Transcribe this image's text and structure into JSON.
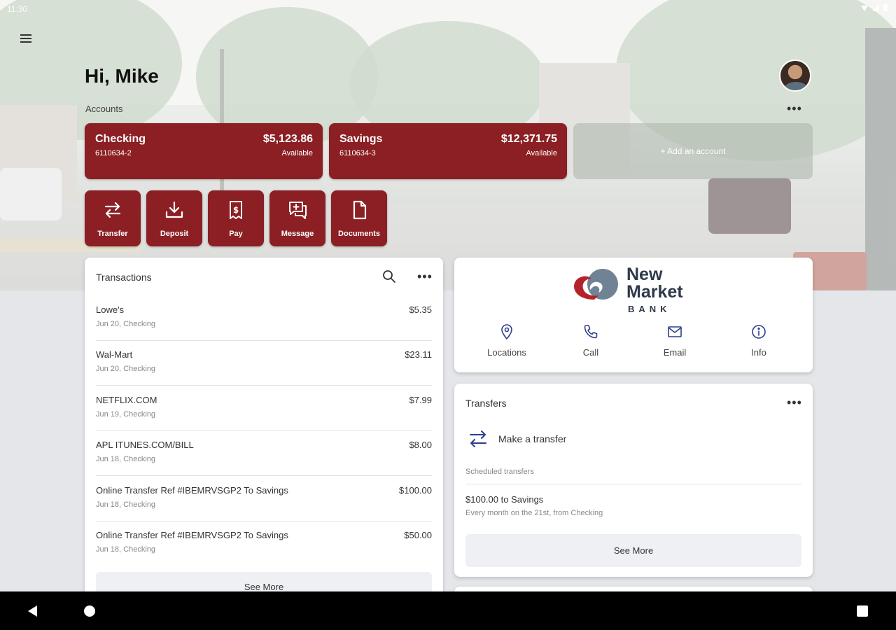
{
  "status_bar": {
    "time": "11:30"
  },
  "header": {
    "greeting": "Hi, Mike",
    "accounts_label": "Accounts",
    "more_label": "•••"
  },
  "accounts": [
    {
      "name": "Checking",
      "number": "6110634-2",
      "balance": "$5,123.86",
      "balance_label": "Available"
    },
    {
      "name": "Savings",
      "number": "6110634-3",
      "balance": "$12,371.75",
      "balance_label": "Available"
    }
  ],
  "add_account_label": "+ Add an account",
  "quick_actions": [
    {
      "label": "Transfer",
      "icon": "transfer-icon"
    },
    {
      "label": "Deposit",
      "icon": "deposit-icon"
    },
    {
      "label": "Pay",
      "icon": "pay-icon"
    },
    {
      "label": "Message",
      "icon": "message-icon"
    },
    {
      "label": "Documents",
      "icon": "documents-icon"
    }
  ],
  "transactions": {
    "title": "Transactions",
    "more_label": "•••",
    "items": [
      {
        "description": "Lowe's",
        "meta": "Jun 20, Checking",
        "amount": "$5.35"
      },
      {
        "description": "Wal-Mart",
        "meta": "Jun 20, Checking",
        "amount": "$23.11"
      },
      {
        "description": "NETFLIX.COM",
        "meta": "Jun 19, Checking",
        "amount": "$7.99"
      },
      {
        "description": "APL ITUNES.COM/BILL",
        "meta": "Jun 18, Checking",
        "amount": "$8.00"
      },
      {
        "description": "Online Transfer Ref #IBEMRVSGP2 To Savings",
        "meta": "Jun 18, Checking",
        "amount": "$100.00"
      },
      {
        "description": "Online Transfer Ref #IBEMRVSGP2 To Savings",
        "meta": "Jun 18, Checking",
        "amount": "$50.00"
      }
    ],
    "see_more": "See More"
  },
  "bank": {
    "logo_line1": "New",
    "logo_line2": "Market",
    "logo_line3": "BANK",
    "contacts": [
      {
        "label": "Locations",
        "icon": "location-pin-icon"
      },
      {
        "label": "Call",
        "icon": "phone-icon"
      },
      {
        "label": "Email",
        "icon": "email-icon"
      },
      {
        "label": "Info",
        "icon": "info-icon"
      }
    ],
    "logo_colors": {
      "red": "#b5232a",
      "slate": "#6f8394"
    }
  },
  "transfers": {
    "title": "Transfers",
    "more_label": "•••",
    "make_transfer": "Make a transfer",
    "scheduled_label": "Scheduled transfers",
    "scheduled": [
      {
        "main": "$100.00 to Savings",
        "sub": "Every month on the 21st, from Checking"
      }
    ],
    "see_more": "See More"
  },
  "colors": {
    "accent": "#8b1f24",
    "icon_navy": "#2e3e8c",
    "background": "#e4e6ea"
  }
}
